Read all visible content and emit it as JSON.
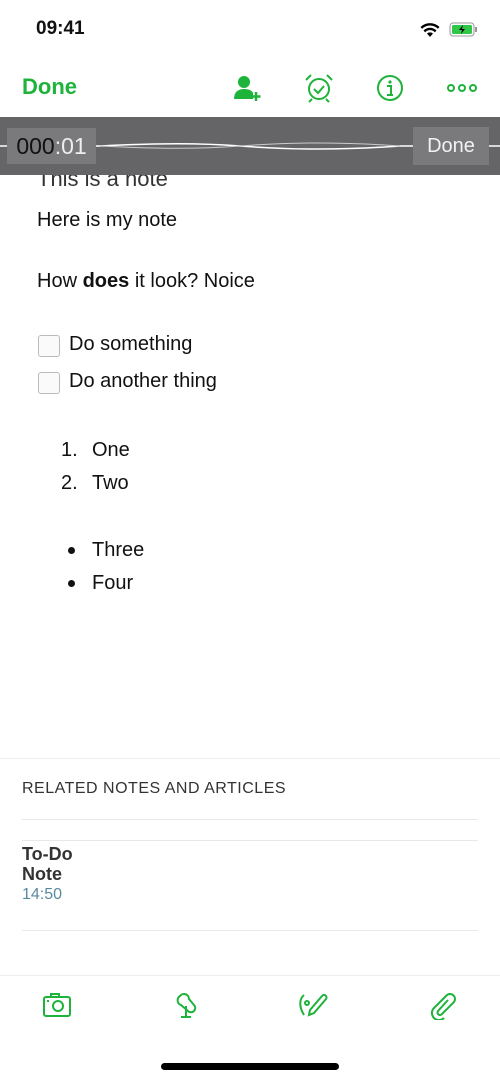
{
  "status_bar": {
    "time": "09:41"
  },
  "nav": {
    "done_label": "Done",
    "icons": [
      "add-user-icon",
      "alarm-icon",
      "info-icon",
      "more-icon"
    ]
  },
  "recording": {
    "timer_prefix": "000",
    "timer_suffix": ":01",
    "done_label": "Done"
  },
  "note": {
    "title": "This is a note",
    "line1": "Here is my note",
    "line2_pre": "How ",
    "line2_bold": "does",
    "line2_post": " it look? Noice",
    "checklist": [
      {
        "label": "Do something",
        "checked": false
      },
      {
        "label": "Do another thing",
        "checked": false
      }
    ],
    "ordered": [
      {
        "num": "1.",
        "label": "One"
      },
      {
        "num": "2.",
        "label": "Two"
      }
    ],
    "bullets": [
      "Three",
      "Four"
    ]
  },
  "related": {
    "header": "RELATED NOTES AND ARTICLES",
    "items": [
      {
        "title_line1": "To-Do",
        "title_line2": "Note",
        "time": "14:50"
      }
    ]
  },
  "toolbar": {
    "icons": [
      "camera-icon",
      "microphone-icon",
      "sketch-icon",
      "paperclip-icon"
    ]
  },
  "colors": {
    "accent": "#1eb33b",
    "recording_bar": "#656466"
  }
}
